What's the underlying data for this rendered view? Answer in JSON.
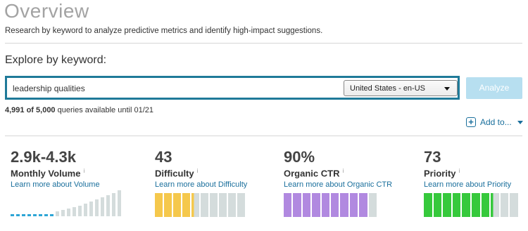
{
  "header": {
    "title": "Overview",
    "subtitle": "Research by keyword to analyze predictive metrics and identify high-impact suggestions."
  },
  "explore": {
    "title": "Explore by keyword:",
    "keyword": "leadership qualities",
    "locale": "United States - en-US",
    "analyze_label": "Analyze"
  },
  "quota": {
    "used_text": "4,991 of 5,000",
    "rest_text": " queries available until 01/21"
  },
  "add_to": {
    "label": "Add to..."
  },
  "metrics": [
    {
      "value": "2.9k-4.3k",
      "label": "Monthly Volume",
      "link": "Learn more about Volume"
    },
    {
      "value": "43",
      "label": "Difficulty",
      "link": "Learn more about Difficulty",
      "level": 0.43
    },
    {
      "value": "90%",
      "label": "Organic CTR",
      "link": "Learn more about Organic CTR",
      "level": 0.9
    },
    {
      "value": "73",
      "label": "Priority",
      "link": "Learn more about Priority",
      "level": 0.73
    }
  ],
  "colors": {
    "volume": "#2ea6d6",
    "difficulty": "#f5c84c",
    "ctr": "#b189e0",
    "priority": "#36c93c",
    "bar_empty": "#d4dcdc",
    "accent": "#1a6f9c"
  }
}
